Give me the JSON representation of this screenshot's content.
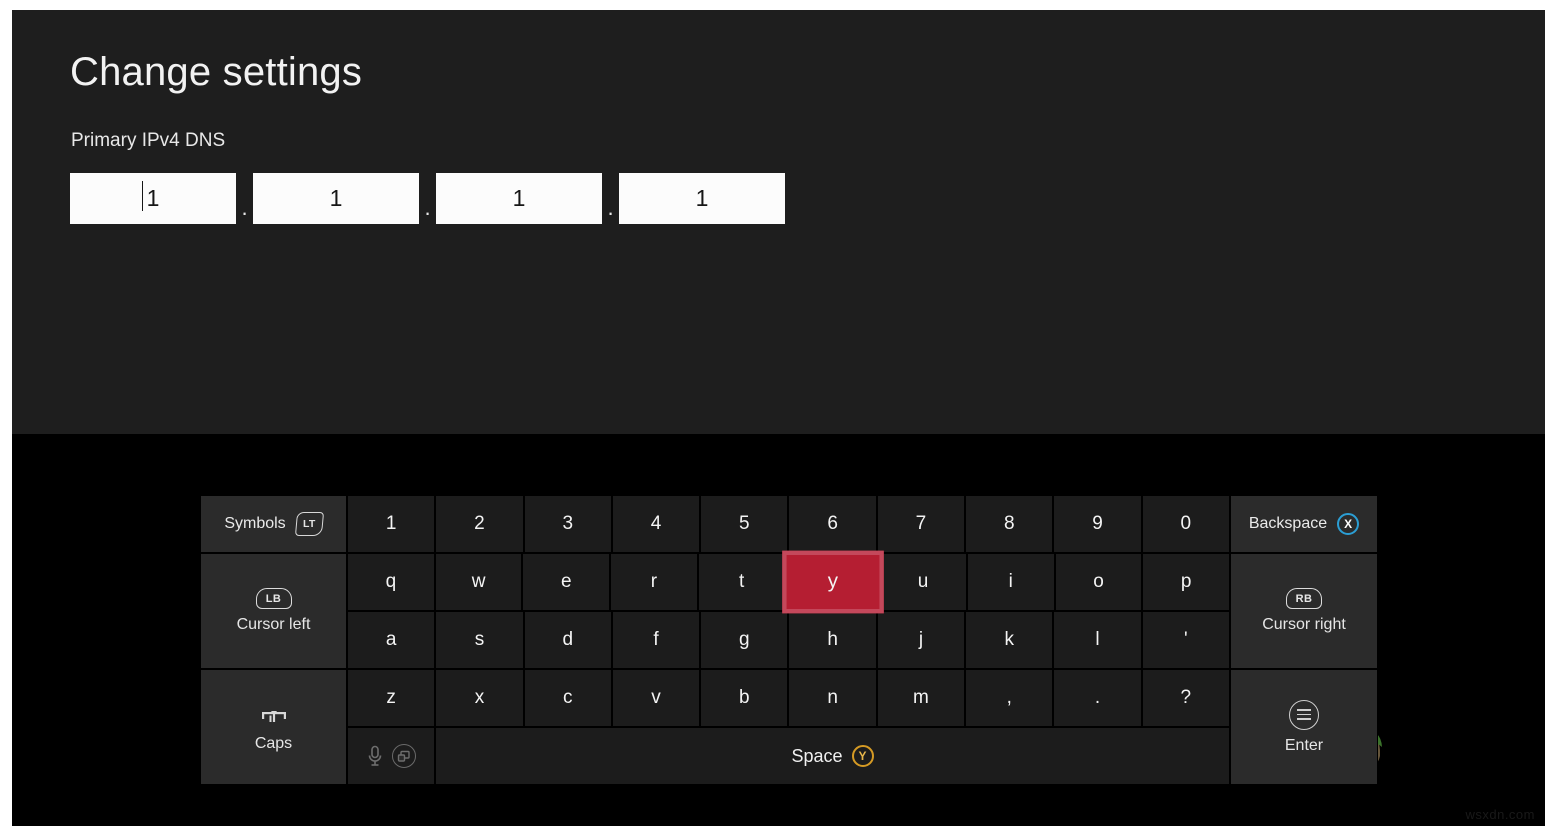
{
  "settings": {
    "title": "Change settings",
    "field_label": "Primary IPv4 DNS",
    "octets": [
      "1",
      "1",
      "1",
      "1"
    ],
    "separator": ".",
    "focused_index": 0
  },
  "keyboard": {
    "rows": {
      "numbers": [
        "1",
        "2",
        "3",
        "4",
        "5",
        "6",
        "7",
        "8",
        "9",
        "0"
      ],
      "top_letters": [
        "q",
        "w",
        "e",
        "r",
        "t",
        "y",
        "u",
        "i",
        "o",
        "p"
      ],
      "home_letters": [
        "a",
        "s",
        "d",
        "f",
        "g",
        "h",
        "j",
        "k",
        "l",
        "'"
      ],
      "bottom_letters": [
        "z",
        "x",
        "c",
        "v",
        "b",
        "n",
        "m",
        ",",
        ".",
        "?"
      ]
    },
    "highlighted_key": "y",
    "symbols": {
      "label": "Symbols",
      "button_glyph": "LT",
      "icon": "left-trigger-icon"
    },
    "cursor_left": {
      "label": "Cursor left",
      "button_glyph": "LB",
      "icon": "left-bumper-icon"
    },
    "cursor_right": {
      "label": "Cursor right",
      "button_glyph": "RB",
      "icon": "right-bumper-icon"
    },
    "caps": {
      "label": "Caps",
      "icon": "caps-lock-icon"
    },
    "backspace": {
      "label": "Backspace",
      "button_glyph": "X",
      "icon": "x-button-icon"
    },
    "enter": {
      "label": "Enter",
      "icon": "menu-button-icon"
    },
    "space": {
      "label": "Space",
      "button_glyph": "Y",
      "icon": "y-button-icon"
    },
    "dictation": {
      "mic_icon": "microphone-icon",
      "view_icon": "view-button-icon"
    }
  },
  "colors": {
    "panel_bg": "#1e1e1e",
    "keyboard_bg": "#000000",
    "key_bg": "#1c1c1c",
    "side_key_bg": "#2b2b2b",
    "highlight_fill": "#b51e32",
    "highlight_border": "#c4485b",
    "x_button": "#2b9ed4",
    "y_button": "#d59a24",
    "text": "#f2f2f2"
  },
  "watermark": {
    "text": "wsxdn.com"
  }
}
